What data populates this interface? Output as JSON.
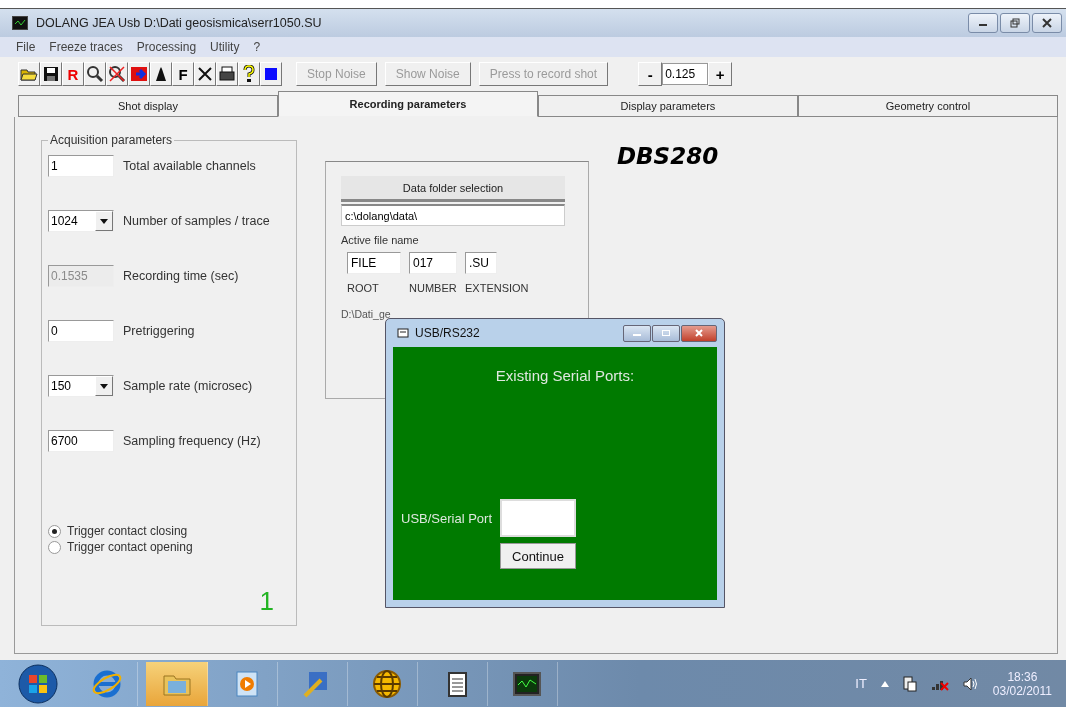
{
  "window": {
    "title": "DOLANG JEA Usb D:\\Dati geosismica\\serr1050.SU"
  },
  "menu": [
    "File",
    "Freeze traces",
    "Processing",
    "Utility",
    "?"
  ],
  "toolbar": [
    {
      "kind": "open"
    },
    {
      "kind": "save"
    },
    {
      "kind": "glyph",
      "text": "R"
    },
    {
      "kind": "zoom"
    },
    {
      "kind": "unzoom"
    },
    {
      "kind": "export"
    },
    {
      "kind": "peak"
    },
    {
      "kind": "glyph",
      "text": "F"
    },
    {
      "kind": "cross"
    },
    {
      "kind": "print"
    },
    {
      "kind": "help"
    },
    {
      "kind": "stop"
    }
  ],
  "toolbar_buttons": [
    {
      "label": "Stop Noise",
      "disabled": true
    },
    {
      "label": "Show Noise",
      "disabled": true
    },
    {
      "label": "Press to record shot",
      "disabled": true
    }
  ],
  "gain": {
    "minus": "-",
    "value": "0.125",
    "plus": "+"
  },
  "tabs": [
    {
      "label": "Shot display",
      "selected": false
    },
    {
      "label": "Recording parameters",
      "selected": true
    },
    {
      "label": "Display parameters",
      "selected": false
    },
    {
      "label": "Geometry control",
      "selected": false
    }
  ],
  "acquisition": {
    "title": "Acquisition parameters",
    "fields": [
      {
        "kind": "text",
        "value": "1",
        "label": "Total available channels",
        "disabled": false
      },
      {
        "kind": "dropdown",
        "value": "1024",
        "label": "Number of samples / trace",
        "disabled": false
      },
      {
        "kind": "text",
        "value": "0.1535",
        "label": "Recording time (sec)",
        "disabled": true
      },
      {
        "kind": "text",
        "value": "0",
        "label": "Pretriggering",
        "disabled": false
      },
      {
        "kind": "dropdown",
        "value": "150",
        "label": "Sample rate (microsec)",
        "disabled": false
      },
      {
        "kind": "text",
        "value": "6700",
        "label": "Sampling frequency (Hz)",
        "disabled": false
      }
    ],
    "trigger": [
      {
        "label": "Trigger contact closing",
        "selected": true
      },
      {
        "label": "Trigger contact opening",
        "selected": false
      }
    ],
    "counter": "1"
  },
  "file_panel": {
    "button": "Data folder selection",
    "folder": "c:\\dolang\\data\\",
    "active_label": "Active file name",
    "parts": [
      {
        "value": "FILE",
        "caption": "ROOT"
      },
      {
        "value": "017",
        "caption": "NUMBER"
      },
      {
        "value": ".SU",
        "caption": "EXTENSION"
      }
    ],
    "path": "D:\\Dati_ge"
  },
  "logo": "DBS280",
  "dialog": {
    "title": "USB/RS232",
    "heading": "Existing Serial Ports:",
    "port_label": "USB/Serial Port",
    "button": "Continue"
  },
  "taskbar": {
    "apps": [
      {
        "kind": "ie",
        "selected": false
      },
      {
        "kind": "folder",
        "selected": true
      },
      {
        "kind": "media",
        "selected": false
      },
      {
        "kind": "tool",
        "selected": false
      },
      {
        "kind": "globe",
        "selected": false
      },
      {
        "kind": "notes",
        "selected": false
      },
      {
        "kind": "scope",
        "selected": false
      }
    ],
    "language": "IT",
    "time": "18:36",
    "date": "03/02/2011"
  }
}
